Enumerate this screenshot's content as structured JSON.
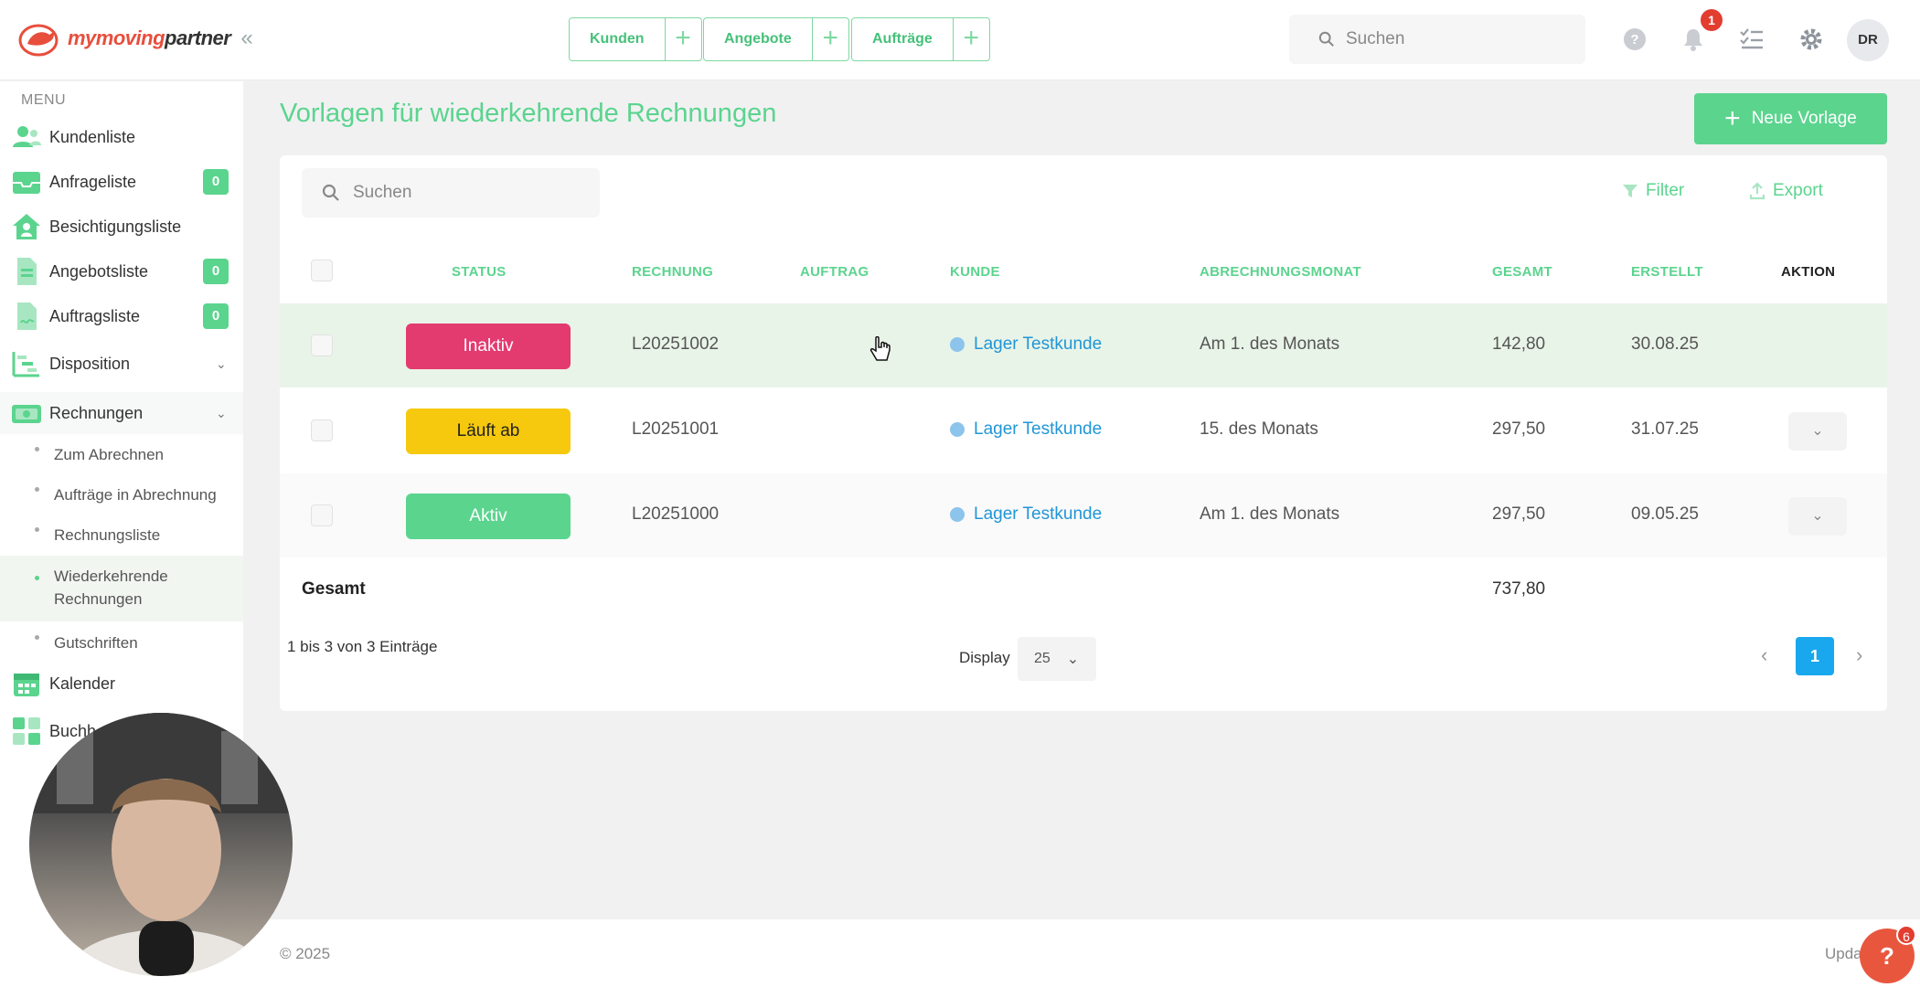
{
  "brand": {
    "name_part1": "my",
    "name_part2": "moving",
    "name_part3": "partner"
  },
  "quick_actions": [
    {
      "label": "Kunden"
    },
    {
      "label": "Angebote"
    },
    {
      "label": "Aufträge"
    }
  ],
  "top_search": {
    "placeholder": "Suchen"
  },
  "notifications": {
    "count": "1"
  },
  "user": {
    "initials": "DR"
  },
  "sidebar": {
    "menu_title": "MENU",
    "items": [
      {
        "label": "Kundenliste"
      },
      {
        "label": "Anfrageliste",
        "count": "0"
      },
      {
        "label": "Besichtigungsliste"
      },
      {
        "label": "Angebotsliste",
        "count": "0"
      },
      {
        "label": "Auftragsliste",
        "count": "0"
      },
      {
        "label": "Disposition"
      },
      {
        "label": "Rechnungen"
      },
      {
        "label": "Kalender"
      },
      {
        "label": "Buchh"
      }
    ],
    "subitems": [
      {
        "label": "Zum Abrechnen"
      },
      {
        "label": "Aufträge in Abrechnung"
      },
      {
        "label": "Rechnungsliste"
      },
      {
        "label": "Wiederkehrende Rechnungen"
      },
      {
        "label": "Gutschriften"
      }
    ]
  },
  "main": {
    "title": "Vorlagen für wiederkehrende Rechnungen",
    "new_button": "Neue Vorlage",
    "search_placeholder": "Suchen",
    "filter_label": "Filter",
    "export_label": "Export",
    "columns": {
      "status": "STATUS",
      "rechnung": "RECHNUNG",
      "auftrag": "AUFTRAG",
      "kunde": "KUNDE",
      "monat": "ABRECHNUNGSMONAT",
      "gesamt": "GESAMT",
      "erstellt": "ERSTELLT",
      "aktion": "AKTION"
    },
    "rows": [
      {
        "status": "Inaktiv",
        "rechnung": "L20251002",
        "auftrag": "",
        "kunde": "Lager Testkunde",
        "monat": "Am 1. des Monats",
        "gesamt": "142,80",
        "erstellt": "30.08.25"
      },
      {
        "status": "Läuft ab",
        "rechnung": "L20251001",
        "auftrag": "",
        "kunde": "Lager Testkunde",
        "monat": "15. des Monats",
        "gesamt": "297,50",
        "erstellt": "31.07.25"
      },
      {
        "status": "Aktiv",
        "rechnung": "L20251000",
        "auftrag": "",
        "kunde": "Lager Testkunde",
        "monat": "Am 1. des Monats",
        "gesamt": "297,50",
        "erstellt": "09.05.25"
      }
    ],
    "summary_label": "Gesamt",
    "summary_total": "737,80",
    "entries_info": "1 bis 3 von 3 Einträge",
    "display_label": "Display",
    "display_value": "25",
    "current_page": "1"
  },
  "colors": {
    "accent": "#5bd48e",
    "status_inactive": "#e33a6f",
    "status_expiring": "#f6c90e",
    "status_active": "#5bd48e",
    "link": "#2196d6",
    "page_active": "#19a8ee"
  },
  "footer": {
    "copyright": "© 2025",
    "update_text": "Upda"
  },
  "help": {
    "label": "?",
    "badge": "6"
  }
}
